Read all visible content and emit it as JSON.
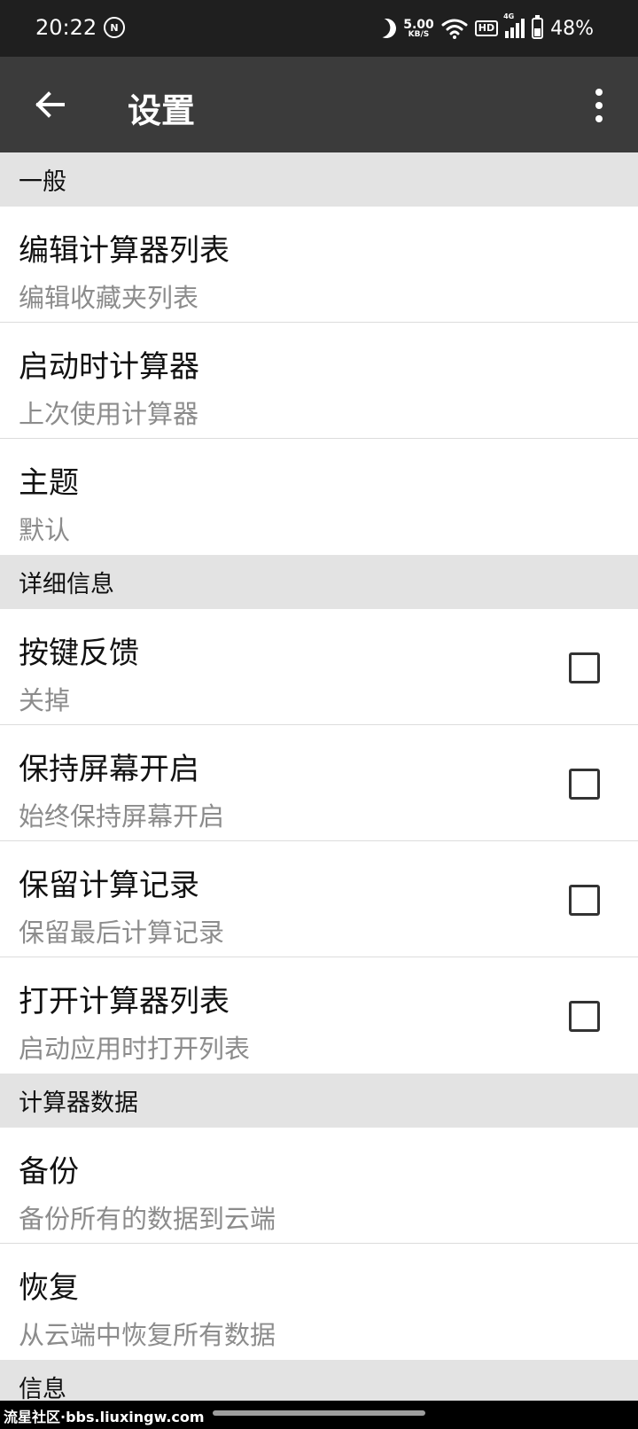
{
  "status_bar": {
    "time": "20:22",
    "mode_icon": "nfc-off-icon",
    "net_speed_value": "5.00",
    "net_speed_unit": "KB/S",
    "hd": "HD",
    "network_type": "4G",
    "battery": "48%"
  },
  "app_bar": {
    "title": "设置",
    "back_icon": "arrow-left-icon",
    "more_icon": "more-vert-icon",
    "background": "#3b3b3b"
  },
  "sections": {
    "general": {
      "title": "一般"
    },
    "details": {
      "title": "详细信息"
    },
    "data": {
      "title": "计算器数据"
    },
    "info": {
      "title": "信息"
    }
  },
  "items": {
    "edit_list": {
      "title": "编辑计算器列表",
      "summary": "编辑收藏夹列表"
    },
    "startup": {
      "title": "启动时计算器",
      "summary": "上次使用计算器"
    },
    "theme": {
      "title": "主题",
      "summary": "默认"
    },
    "key_feedback": {
      "title": "按键反馈",
      "summary": "关掉",
      "checked": false
    },
    "keep_screen": {
      "title": "保持屏幕开启",
      "summary": "始终保持屏幕开启",
      "checked": false
    },
    "keep_history": {
      "title": "保留计算记录",
      "summary": "保留最后计算记录",
      "checked": false
    },
    "open_list": {
      "title": "打开计算器列表",
      "summary": "启动应用时打开列表",
      "checked": false
    },
    "backup": {
      "title": "备份",
      "summary": "备份所有的数据到云端"
    },
    "restore": {
      "title": "恢复",
      "summary": "从云端中恢复所有数据"
    }
  },
  "watermark": "流星社区·bbs.liuxingw.com"
}
